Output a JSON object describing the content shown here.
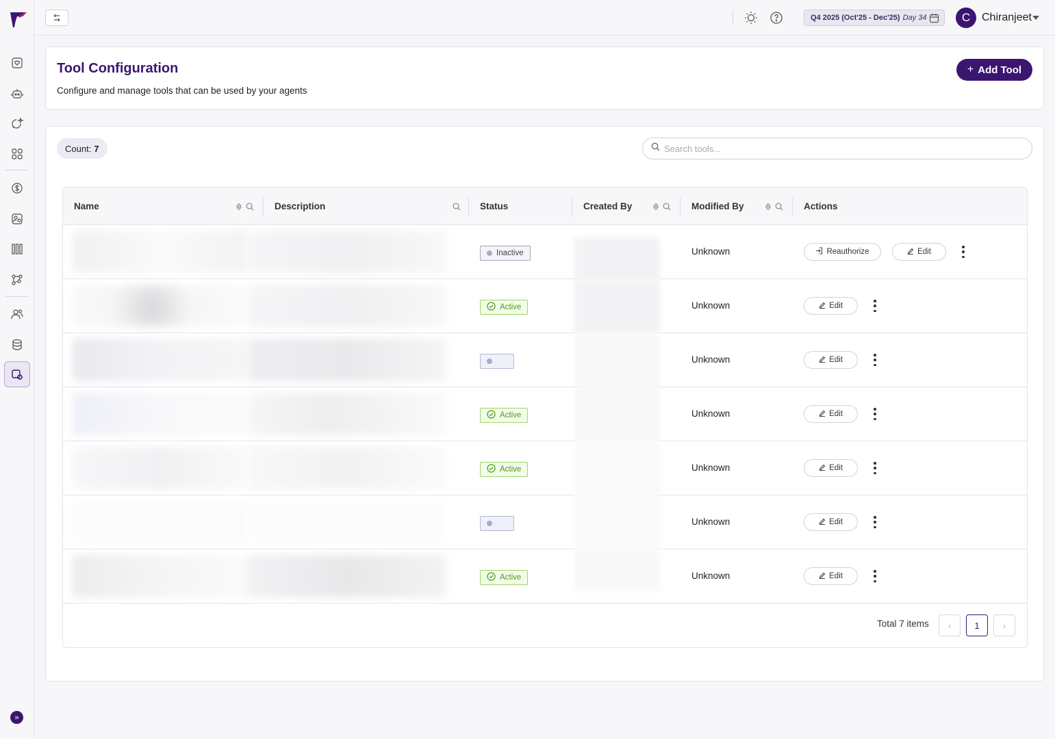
{
  "topbar": {
    "collapse_icon": "swap-arrows-icon",
    "quarter_label": "Q4 2025 (Oct'25 - Dec'25)",
    "quarter_day": "Day 34",
    "user_initial": "C",
    "user_name": "Chiranjeet"
  },
  "sidebar": {
    "items": [
      {
        "icon": "favorites-icon"
      },
      {
        "icon": "agent-robot-icon"
      },
      {
        "icon": "chat-sparkle-icon"
      },
      {
        "icon": "apps-grid-icon"
      },
      {
        "icon": "billing-dollar-icon"
      },
      {
        "icon": "teams-icon"
      },
      {
        "icon": "library-icon"
      },
      {
        "icon": "workflow-icon"
      },
      {
        "icon": "users-icon"
      },
      {
        "icon": "database-icon"
      },
      {
        "icon": "tool-config-icon",
        "active": true
      }
    ]
  },
  "header": {
    "title": "Tool Configuration",
    "subtitle": "Configure and manage tools that can be used by your agents",
    "add_button": "Add Tool"
  },
  "toolbar": {
    "count_label": "Count:",
    "count_value": "7",
    "search_placeholder": "Search tools..."
  },
  "table": {
    "columns": {
      "name": "Name",
      "description": "Description",
      "status": "Status",
      "created_by": "Created By",
      "modified_by": "Modified By",
      "actions": "Actions"
    },
    "rows": [
      {
        "status": "Inactive",
        "status_type": "inactive",
        "modified_by": "Unknown",
        "reauthorize": "Reauthorize",
        "edit": "Edit"
      },
      {
        "status": "Active",
        "status_type": "active",
        "modified_by": "Unknown",
        "edit": "Edit"
      },
      {
        "status": "",
        "status_type": "blank",
        "modified_by": "Unknown",
        "edit": "Edit"
      },
      {
        "status": "Active",
        "status_type": "active",
        "modified_by": "Unknown",
        "edit": "Edit"
      },
      {
        "status": "Active",
        "status_type": "active",
        "modified_by": "Unknown",
        "edit": "Edit"
      },
      {
        "status": "",
        "status_type": "blank",
        "modified_by": "Unknown",
        "edit": "Edit"
      },
      {
        "status": "Active",
        "status_type": "active",
        "modified_by": "Unknown",
        "edit": "Edit"
      }
    ]
  },
  "pagination": {
    "total_label": "Total 7 items",
    "current_page": "1"
  },
  "colors": {
    "brand": "#3b1670",
    "active_green": "#4a9c1c"
  }
}
